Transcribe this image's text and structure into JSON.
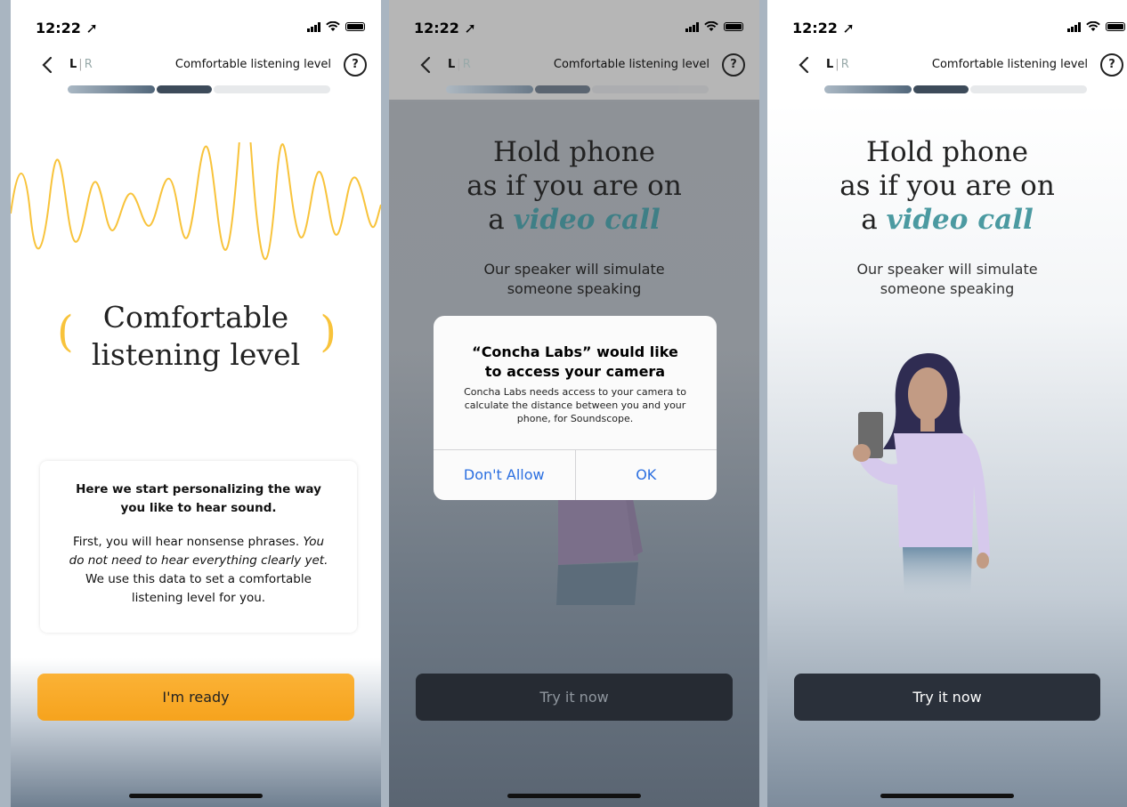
{
  "status_bar": {
    "time": "12:22 ➚"
  },
  "nav": {
    "left_ear": "L",
    "separator": "|",
    "right_ear": "R",
    "title": "Comfortable listening level",
    "help_icon": "?"
  },
  "screen1": {
    "title_line1": "Comfortable",
    "title_line2": "listening level",
    "paren_open": "(",
    "paren_close": ")",
    "card_title": "Here we start personalizing the way you like to hear sound.",
    "card_body_1": "First, you will hear nonsense phrases.",
    "card_body_italic": "You do not need to hear everything clearly yet.",
    "card_body_2": "We use this data to set a comfortable listening level for you.",
    "cta": "I'm ready",
    "accent_color": "#f8c33b",
    "button_color": "#fbaa27"
  },
  "screen2": {
    "headline_line1": "Hold phone",
    "headline_line2": "as if you are on",
    "headline_prefix": "a ",
    "headline_highlight": "video call",
    "sub_line1": "Our speaker will simulate",
    "sub_line2": "someone speaking",
    "alert_title_line1": "“Concha Labs” would like",
    "alert_title_line2": "to access your camera",
    "alert_body": "Concha Labs needs access to your camera to calculate the distance between you and your phone, for Soundscope.",
    "alert_deny": "Don't Allow",
    "alert_ok": "OK",
    "cta": "Try it now"
  },
  "screen3": {
    "headline_line1": "Hold phone",
    "headline_line2": "as if you are on",
    "headline_prefix": "a ",
    "headline_highlight": "video call",
    "sub_line1": "Our speaker will simulate",
    "sub_line2": "someone speaking",
    "cta": "Try it now"
  }
}
